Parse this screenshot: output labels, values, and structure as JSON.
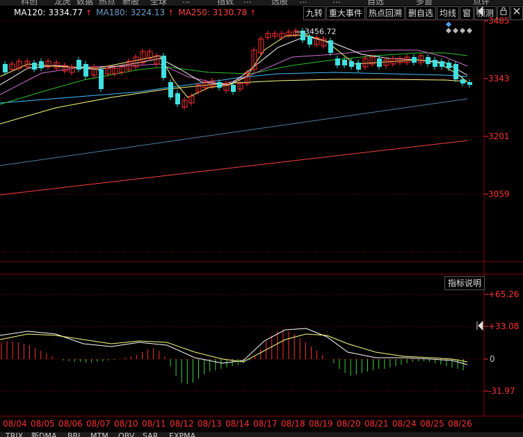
{
  "toolbar_top": [
    "科创",
    "龙虎",
    "数据",
    "热点",
    "新股",
    "全球",
    "...",
    "指数",
    "...",
    "选股",
    "...",
    "...",
    "自选",
    "多窗",
    "点评"
  ],
  "ma_legend": [
    {
      "label": "MA120: 3334.77",
      "color": "#ffffff",
      "arrow": "↑"
    },
    {
      "label": "MA180: 3224.13",
      "color": "#6fa0c8",
      "arrow": "↑"
    },
    {
      "label": "MA250: 3130.78",
      "color": "#ff4040",
      "arrow": "↑"
    }
  ],
  "buttons": [
    "九转",
    "重大事件",
    "热点回溯",
    "删自选",
    "均线",
    "窗",
    "预测"
  ],
  "lock_icon": "lock-icon",
  "close_icon": "close-icon",
  "price_axis": [
    "3485",
    "3343",
    "3201",
    "3059"
  ],
  "peak_label": "3456.72",
  "indicator_button": "指标说明",
  "macd_axis": [
    "+65.26",
    "+33.08",
    "0",
    "-31.97"
  ],
  "dates": [
    "08/04",
    "08/05",
    "08/06",
    "08/07",
    "08/10",
    "08/11",
    "08/12",
    "08/13",
    "08/14",
    "08/17",
    "08/18",
    "08/19",
    "08/20",
    "08/21",
    "08/24",
    "08/25",
    "08/26"
  ],
  "bottom_tabs": [
    "TRIX",
    "新DMA",
    "BBI",
    "MTM",
    "OBV",
    "SAR",
    "EXPMA"
  ],
  "colors": {
    "up": "#ff3030",
    "down": "#40e0e0",
    "grid": "#8b0000",
    "yellow": "#ffff80",
    "white": "#ffffff"
  }
}
